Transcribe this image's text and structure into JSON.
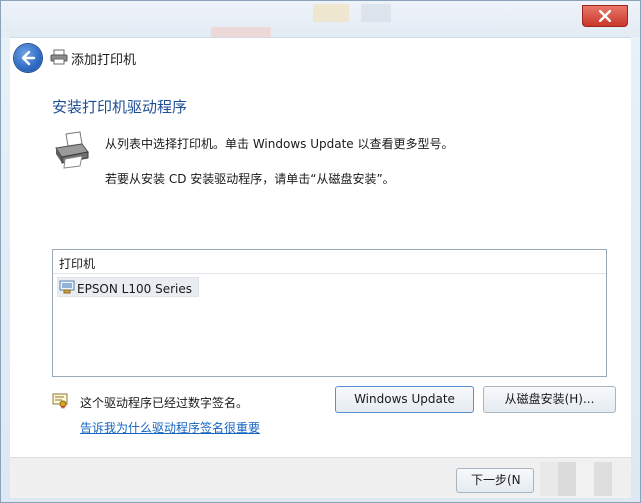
{
  "window": {
    "nav_title": "添加打印机"
  },
  "main": {
    "heading": "安装打印机驱动程序",
    "description_line1": "从列表中选择打印机。单击 Windows Update 以查看更多型号。",
    "description_line2": "若要从安装 CD 安装驱动程序，请单击“从磁盘安装”。"
  },
  "printer_list": {
    "header": "打印机",
    "items": [
      {
        "label": "EPSON L100 Series"
      }
    ]
  },
  "signature": {
    "status_text": "这个驱动程序已经过数字签名。",
    "link_text": "告诉我为什么驱动程序签名很重要"
  },
  "buttons": {
    "windows_update": "Windows Update",
    "have_disk": "从磁盘安装(H)...",
    "next": "下一步(N"
  },
  "colors": {
    "heading": "#1f4e96",
    "link": "#1565c0",
    "close_button": "#c9362a"
  }
}
